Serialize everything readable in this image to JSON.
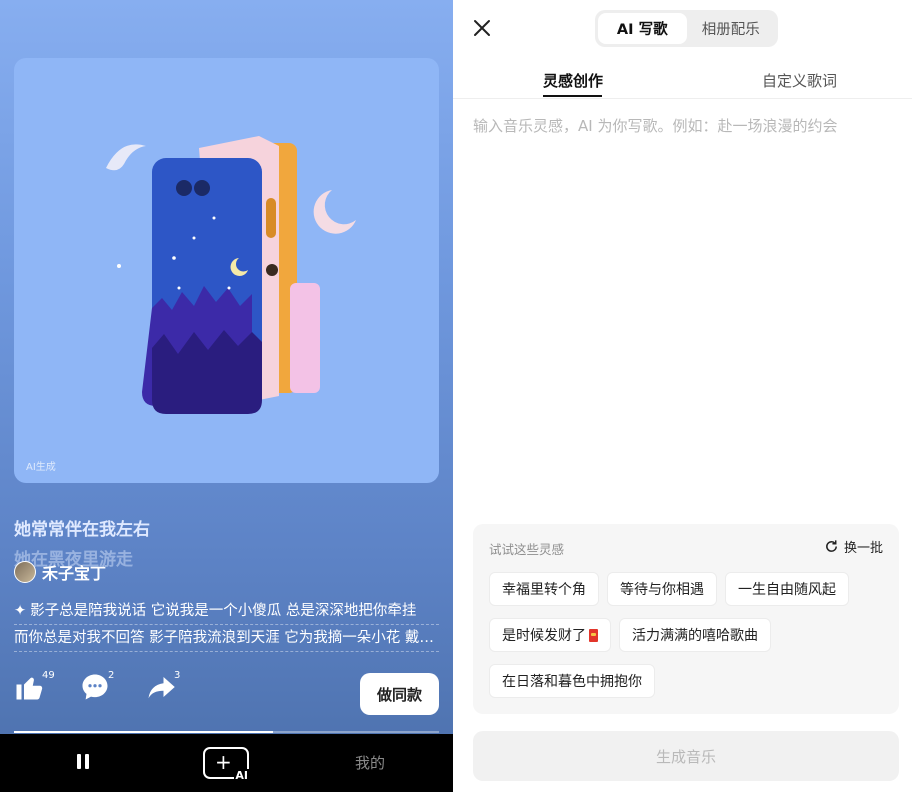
{
  "player": {
    "cover_watermark": "AI生成",
    "lyric_current": "她常常伴在我左右",
    "lyric_next": "她在黑夜里游走",
    "author_name": "禾子宝丁",
    "description_line1": "影子总是陪我说话 它说我是一个小傻瓜 总是深深地把你牵挂",
    "description_line2": "而你总是对我不回答 影子陪我流浪到天涯 它为我摘一朵小花 戴…",
    "likes_count": "49",
    "comments_count": "2",
    "shares_count": "3",
    "make_same_label": "做同款",
    "progress_fraction": 0.61,
    "icons": {
      "like": "thumbs-up-icon",
      "comment": "comment-icon",
      "share": "share-icon",
      "spark": "sparkle-icon"
    }
  },
  "bottom_nav": {
    "ai_label": "AI",
    "mine_label": "我的",
    "icons": {
      "pause": "pause-icon",
      "create": "create-ai-icon"
    }
  },
  "composer": {
    "segments": [
      "AI 写歌",
      "相册配乐"
    ],
    "active_segment": "AI 写歌",
    "tabs": [
      "灵感创作",
      "自定义歌词"
    ],
    "active_tab": "灵感创作",
    "prompt_placeholder": "输入音乐灵感，AI 为你写歌。例如：赴一场浪漫的约会",
    "inspiration_title": "试试这些灵感",
    "refresh_label": "换一批",
    "chips": [
      "幸福里转个角",
      "等待与你相遇",
      "一生自由随风起",
      "是时候发财了",
      "活力满满的嘻哈歌曲",
      "在日落和暮色中拥抱你"
    ],
    "generate_label": "生成音乐",
    "icons": {
      "close": "close-icon",
      "refresh": "refresh-icon",
      "red_envelope": "red-envelope-icon"
    }
  },
  "colors": {
    "left_bg_top": "#87aef0",
    "left_bg_bottom": "#4b6faa",
    "nav_bg": "#000000",
    "accent_text": "#111111",
    "disabled": "#b9b9b9"
  }
}
